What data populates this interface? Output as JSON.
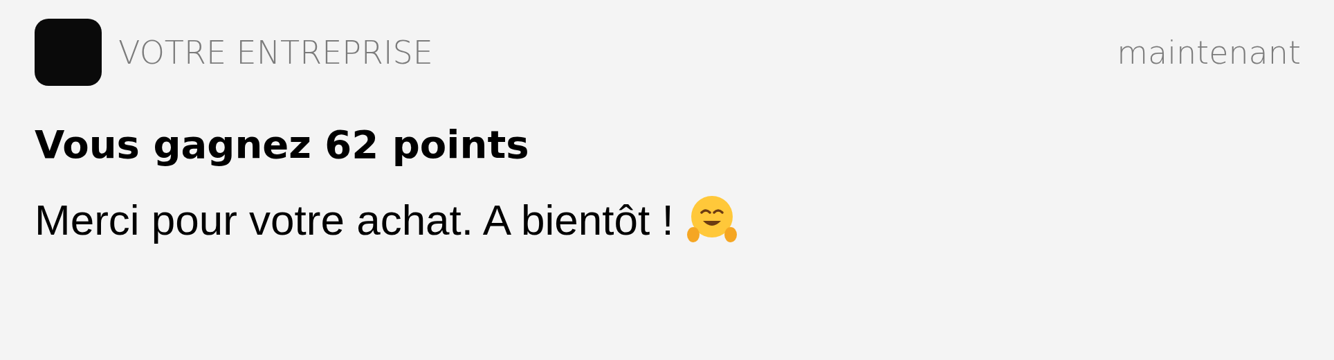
{
  "notification": {
    "app_name": "VOTRE ENTREPRISE",
    "time": "maintenant",
    "title": "Vous gagnez 62 points",
    "body": "Merci pour votre achat. A bientôt !"
  }
}
